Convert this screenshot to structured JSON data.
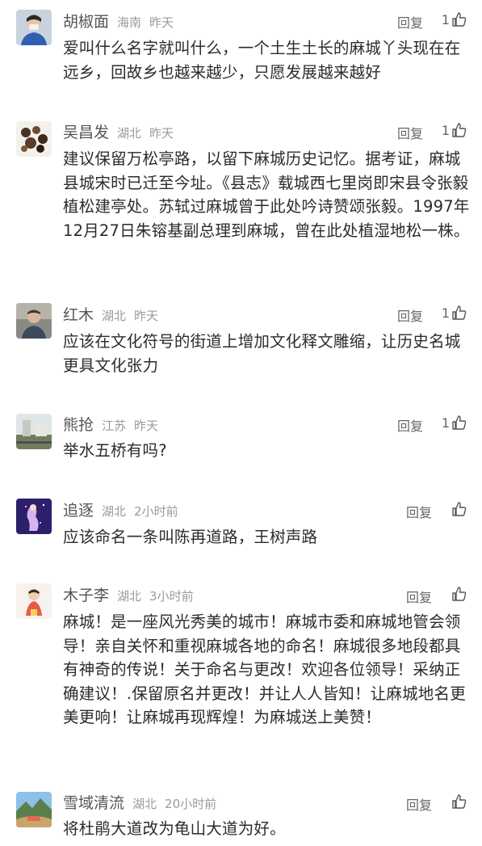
{
  "reply_label": "回复",
  "comments": [
    {
      "username": "胡椒面",
      "region": "海南",
      "time": "昨天",
      "likes": "1",
      "text": "爱叫什么名字就叫什么，一个土生土长的麻城丫头现在在远乡，回故乡也越来越少，只愿发展越来越好"
    },
    {
      "username": "吴昌发",
      "region": "湖北",
      "time": "昨天",
      "likes": "1",
      "text": "建议保留万松亭路，以留下麻城历史记忆。据考证，麻城县城宋时已迁至今址。《县志》载城西七里岗即宋县令张毅植松建亭处。苏轼过麻城曾于此处吟诗赞颂张毅。1997年12月27日朱镕基副总理到麻城，曾在此处植湿地松一株。"
    },
    {
      "username": "红木",
      "region": "湖北",
      "time": "昨天",
      "likes": "1",
      "text": "应该在文化符号的街道上增加文化释文雕缩，让历史名城更具文化张力"
    },
    {
      "username": "熊抢",
      "region": "江苏",
      "time": "昨天",
      "likes": "1",
      "text": "举水五桥有吗?"
    },
    {
      "username": "追逐",
      "region": "湖北",
      "time": "2小时前",
      "likes": "",
      "text": "应该命名一条叫陈再道路，王树声路"
    },
    {
      "username": "木子李",
      "region": "湖北",
      "time": "3小时前",
      "likes": "",
      "text": "麻城！是一座风光秀美的城市！麻城市委和麻城地管会领导！亲自关怀和重视麻城各地的命名！麻城很多地段都具有神奇的传说！关于命名与更改！欢迎各位领导！采纳正确建议！.保留原名并更改！并让人人皆知！让麻城地名更美更响！让麻城再现辉煌！为麻城送上美赞！"
    },
    {
      "username": "雪域清流",
      "region": "湖北",
      "time": "20小时前",
      "likes": "",
      "text": "将杜鹃大道改为龟山大道为好。"
    }
  ],
  "icons": {
    "like": "thumbs-up-icon"
  },
  "colors": {
    "text": "#2b2b2b",
    "meta": "#9a9a9a",
    "username": "#555555"
  }
}
